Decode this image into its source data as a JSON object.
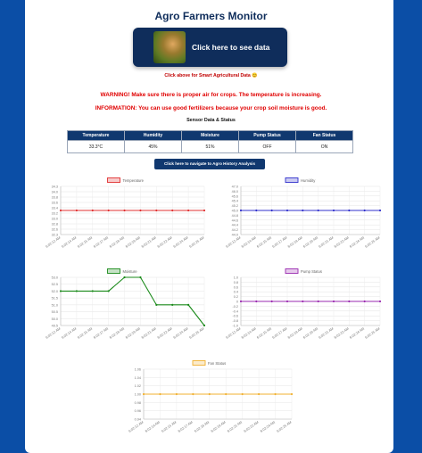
{
  "app": {
    "title": "Agro Farmers Monitor"
  },
  "hero": {
    "label": "Click here to see data",
    "note": "Click above for Smart Agricultural Data 😊"
  },
  "alerts": {
    "warning": "WARNING! Make sure there is proper air for crops. The temperature is increasing.",
    "information": "INFORMATION: You can use good fertilizers because your crop soil moisture is good."
  },
  "sensor": {
    "title": "Sensor Data & Status",
    "headers": [
      "Temperature",
      "Humidity",
      "Moisture",
      "Pump Status",
      "Fan Status"
    ],
    "values": [
      "33.3°C",
      "45%",
      "51%",
      "OFF",
      "ON"
    ]
  },
  "nav": {
    "history_label": "Click here to navigate to Agro History Analysis"
  },
  "colors": {
    "temperature": "#e03030",
    "humidity": "#3030cc",
    "moisture": "#1a8a1a",
    "pump": "#9a2ab0",
    "fan": "#f0b030",
    "header": "#10386f"
  },
  "chart_data": [
    {
      "type": "line",
      "legend": "Temperature",
      "color": "#e03030",
      "x": [
        "6:02:12 AM",
        "6:02:14 AM",
        "6:02:15 AM",
        "6:02:17 AM",
        "6:02:18 AM",
        "6:02:19 AM",
        "6:02:21 AM",
        "6:02:22 AM",
        "6:02:24 AM",
        "6:02:25 AM"
      ],
      "values": [
        33.3,
        33.3,
        33.3,
        33.3,
        33.3,
        33.3,
        33.3,
        33.3,
        33.3,
        33.3
      ],
      "ylim": [
        32.3,
        34.3
      ],
      "yticks": [
        "34.3",
        "34.0",
        "33.8",
        "33.6",
        "33.4",
        "33.2",
        "33.0",
        "32.8",
        "32.6",
        "32.3"
      ]
    },
    {
      "type": "line",
      "legend": "Humidity",
      "color": "#3030cc",
      "x": [
        "6:02:12 AM",
        "6:02:14 AM",
        "6:02:15 AM",
        "6:02:17 AM",
        "6:02:18 AM",
        "6:02:19 AM",
        "6:02:21 AM",
        "6:02:22 AM",
        "6:02:24 AM",
        "6:02:25 AM"
      ],
      "values": [
        45,
        45,
        45,
        45,
        45,
        45,
        45,
        45,
        45,
        45
      ],
      "ylim": [
        44.0,
        46.0
      ],
      "yticks": [
        "47.0",
        "46.0",
        "45.6",
        "45.4",
        "45.2",
        "45.0",
        "44.8",
        "44.6",
        "44.4",
        "44.2",
        "44.0"
      ]
    },
    {
      "type": "line",
      "legend": "Moisture",
      "color": "#1a8a1a",
      "x": [
        "6:02:12 AM",
        "6:02:14 AM",
        "6:02:15 AM",
        "6:02:17 AM",
        "6:02:18 AM",
        "6:02:19 AM",
        "6:02:21 AM",
        "6:02:22 AM",
        "6:02:24 AM",
        "6:02:25 AM"
      ],
      "values": [
        52,
        52,
        52,
        52,
        53,
        53,
        51,
        51,
        51,
        49.5
      ],
      "ylim": [
        49.5,
        53.0
      ],
      "yticks": [
        "53.0",
        "52.5",
        "52.0",
        "51.5",
        "51.0",
        "50.5",
        "50.0",
        "49.5"
      ]
    },
    {
      "type": "line",
      "legend": "Pump Status",
      "color": "#9a2ab0",
      "x": [
        "6:02:12 AM",
        "6:02:14 AM",
        "6:02:15 AM",
        "6:02:17 AM",
        "6:02:18 AM",
        "6:02:19 AM",
        "6:02:21 AM",
        "6:02:22 AM",
        "6:02:24 AM",
        "6:02:25 AM"
      ],
      "values": [
        0,
        0,
        0,
        0,
        0,
        0,
        0,
        0,
        0,
        0
      ],
      "ylim": [
        -1.0,
        1.0
      ],
      "yticks": [
        "1.0",
        "0.8",
        "0.6",
        "0.4",
        "0.2",
        "0",
        "-0.2",
        "-0.4",
        "-0.6",
        "-0.8",
        "-1.0"
      ]
    },
    {
      "type": "line",
      "legend": "Fan Status",
      "color": "#f0b030",
      "x": [
        "6:02:12 AM",
        "6:02:14 AM",
        "6:02:15 AM",
        "6:02:17 AM",
        "6:02:18 AM",
        "6:02:19 AM",
        "6:02:21 AM",
        "6:02:22 AM",
        "6:02:24 AM",
        "6:02:25 AM"
      ],
      "values": [
        1,
        1,
        1,
        1,
        1,
        1,
        1,
        1,
        1,
        1
      ],
      "ylim": [
        0.94,
        1.06
      ],
      "yticks": [
        "1.06",
        "1.04",
        "1.02",
        "1.00",
        "0.98",
        "0.96",
        "0.94"
      ]
    }
  ]
}
